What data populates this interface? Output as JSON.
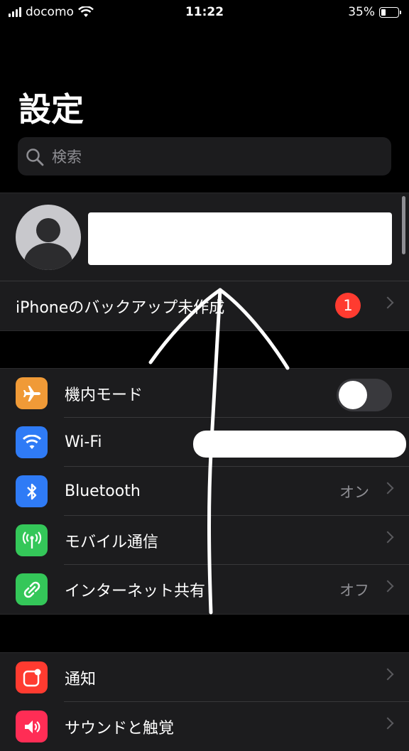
{
  "status_bar": {
    "carrier": "docomo",
    "time": "11:22",
    "battery_percent": "35%",
    "battery_level": 0.35
  },
  "page_title": "設定",
  "search": {
    "placeholder": "検索"
  },
  "profile_group": {
    "backup_label": "iPhoneのバックアップ未作成",
    "backup_badge": "1"
  },
  "connectivity": [
    {
      "label": "機内モード",
      "icon": "airplane-icon",
      "color": "#f09a37",
      "toggle": false
    },
    {
      "label": "Wi-Fi",
      "icon": "wifi-icon",
      "color": "#2f7bf6",
      "value": ""
    },
    {
      "label": "Bluetooth",
      "icon": "bluetooth-icon",
      "color": "#2f7bf6",
      "value": "オン"
    },
    {
      "label": "モバイル通信",
      "icon": "antenna-icon",
      "color": "#34c759",
      "value": ""
    },
    {
      "label": "インターネット共有",
      "icon": "link-icon",
      "color": "#34c759",
      "value": "オフ"
    }
  ],
  "notifications_group": [
    {
      "label": "通知",
      "icon": "notification-icon",
      "color": "#ff3b30"
    },
    {
      "label": "サウンドと触覚",
      "icon": "speaker-icon",
      "color": "#ff2d55"
    }
  ]
}
